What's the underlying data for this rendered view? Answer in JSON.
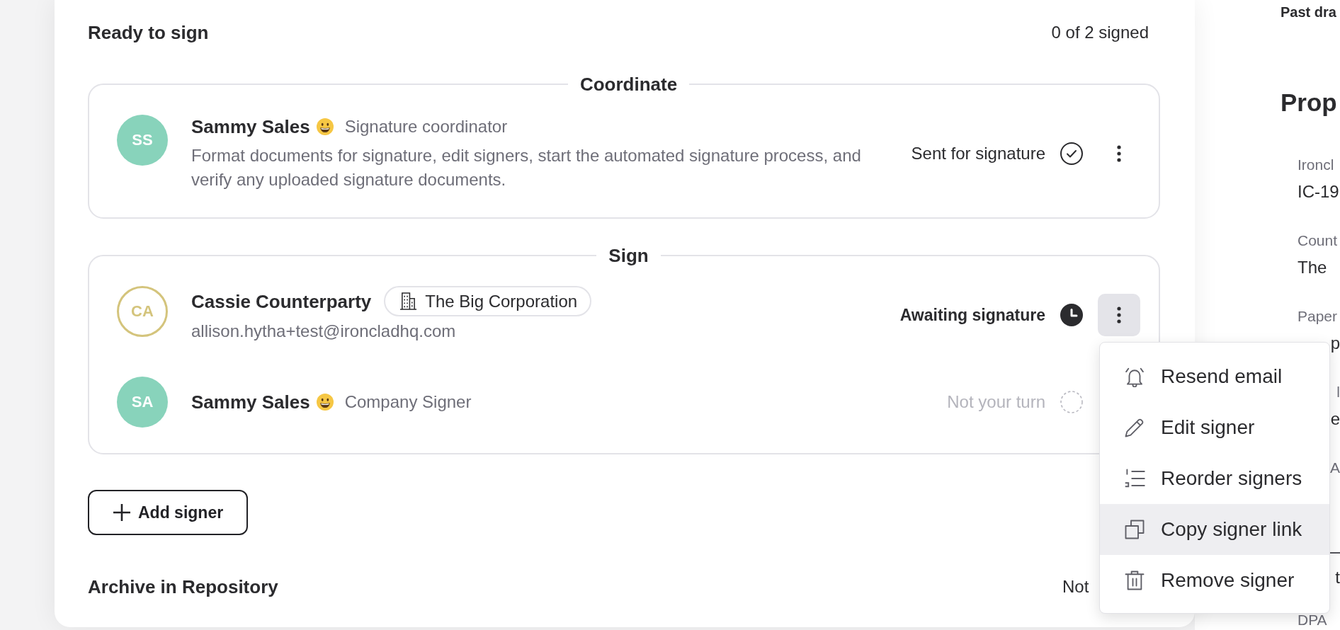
{
  "ready": {
    "title": "Ready to sign",
    "count": "0 of 2 signed"
  },
  "groups": [
    {
      "legend": "Coordinate",
      "signers": [
        {
          "avatar": {
            "initials": "SS",
            "kind": "filled",
            "color": "#88d3bb"
          },
          "name": "Sammy Sales",
          "emoji": true,
          "role": "Signature coordinator",
          "description": "Format documents for signature, edit signers, start the automated signature process, and verify any uploaded signature documents.",
          "status": {
            "text": "Sent for signature",
            "kind": "sent"
          },
          "menu_button": {
            "open": false
          }
        }
      ]
    },
    {
      "legend": "Sign",
      "signers": [
        {
          "avatar": {
            "initials": "CA",
            "kind": "outline",
            "color": "#d4c47c"
          },
          "name": "Cassie Counterparty",
          "emoji": false,
          "company": "The Big Corporation",
          "email": "allison.hytha+test@ironcladhq.com",
          "status": {
            "text": "Awaiting signature",
            "kind": "awaiting"
          },
          "menu_button": {
            "open": true
          }
        },
        {
          "avatar": {
            "initials": "SA",
            "kind": "filled",
            "color": "#88d3bb"
          },
          "name": "Sammy Sales",
          "emoji": true,
          "role": "Company Signer",
          "status": {
            "text": "Not your turn",
            "kind": "waiting"
          }
        }
      ]
    }
  ],
  "add_button": "Add signer",
  "archive": {
    "title": "Archive in Repository",
    "status": "Not"
  },
  "side_panel": {
    "title": "Past dra",
    "heading": "Prop",
    "sections": [
      {
        "lines": [
          {
            "kind": "label",
            "text": "Ironcl"
          },
          {
            "kind": "value",
            "text": "IC-19"
          },
          {
            "kind": "label",
            "text": "Count"
          },
          {
            "kind": "value",
            "text": "The"
          },
          {
            "kind": "label",
            "text": "Paper"
          },
          {
            "kind": "value-tail",
            "text": "p"
          },
          {
            "kind": "label-tail",
            "text": "l"
          },
          {
            "kind": "value-tail",
            "text": "e"
          },
          {
            "kind": "label-tail",
            "text": "A"
          }
        ]
      },
      {
        "lines": [
          {
            "kind": "value-tail",
            "text": "t"
          },
          {
            "kind": "label",
            "text": "DPA"
          }
        ]
      }
    ]
  },
  "menu": {
    "items": [
      {
        "kind": "resend",
        "label": "Resend email",
        "highlighted": false
      },
      {
        "kind": "edit",
        "label": "Edit signer",
        "highlighted": false
      },
      {
        "kind": "reorder",
        "label": "Reorder signers",
        "highlighted": false
      },
      {
        "kind": "copy",
        "label": "Copy signer link",
        "highlighted": true
      },
      {
        "kind": "remove",
        "label": "Remove signer",
        "highlighted": false
      }
    ]
  }
}
